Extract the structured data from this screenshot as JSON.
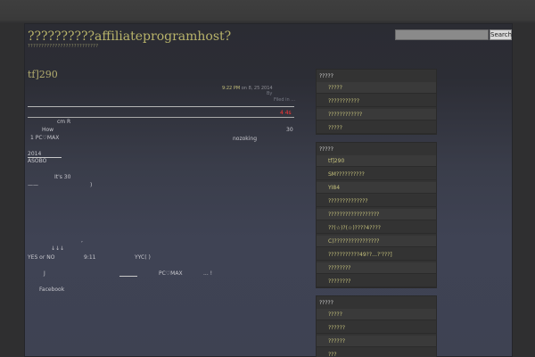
{
  "header": {
    "site_title": "??????????affiliateprogramhost?",
    "site_description": "??????????????????????????",
    "search_placeholder": "",
    "search_button": "Search"
  },
  "post": {
    "title": "tf]290",
    "time": "9:22 PM",
    "date_suffix": " on 8, 25 2014",
    "by": "By",
    "filed": "Filed in ...",
    "comment_badge": "4 4s",
    "lines": [
      "cm     R",
      "How",
      "30",
      "1 PC♡MAX",
      "nozoking",
      "2014",
      "ASOBO",
      "It's        30",
      ")",
      "——",
      ",",
      "↓↓↓",
      "YES or NO",
      "9:11",
      "YYC(      )",
      "J",
      "PC♡MAX",
      "...     !",
      "Facebook"
    ]
  },
  "sidebar": {
    "widget1": {
      "title": "?????",
      "items": [
        "?????",
        "???????????",
        "????????????",
        "?????"
      ]
    },
    "widget2": {
      "title": "?????",
      "items": [
        "tf]290",
        "SM??????????",
        "YI84",
        "??????????????",
        "??????????????????",
        "??(☆)?(☆)????4????",
        "C)????????????????",
        "???????????49??…?'???]",
        "????????",
        "????????"
      ]
    },
    "widget3": {
      "title": "?????",
      "items": [
        "?????",
        "??????",
        "??????",
        "???"
      ]
    }
  }
}
